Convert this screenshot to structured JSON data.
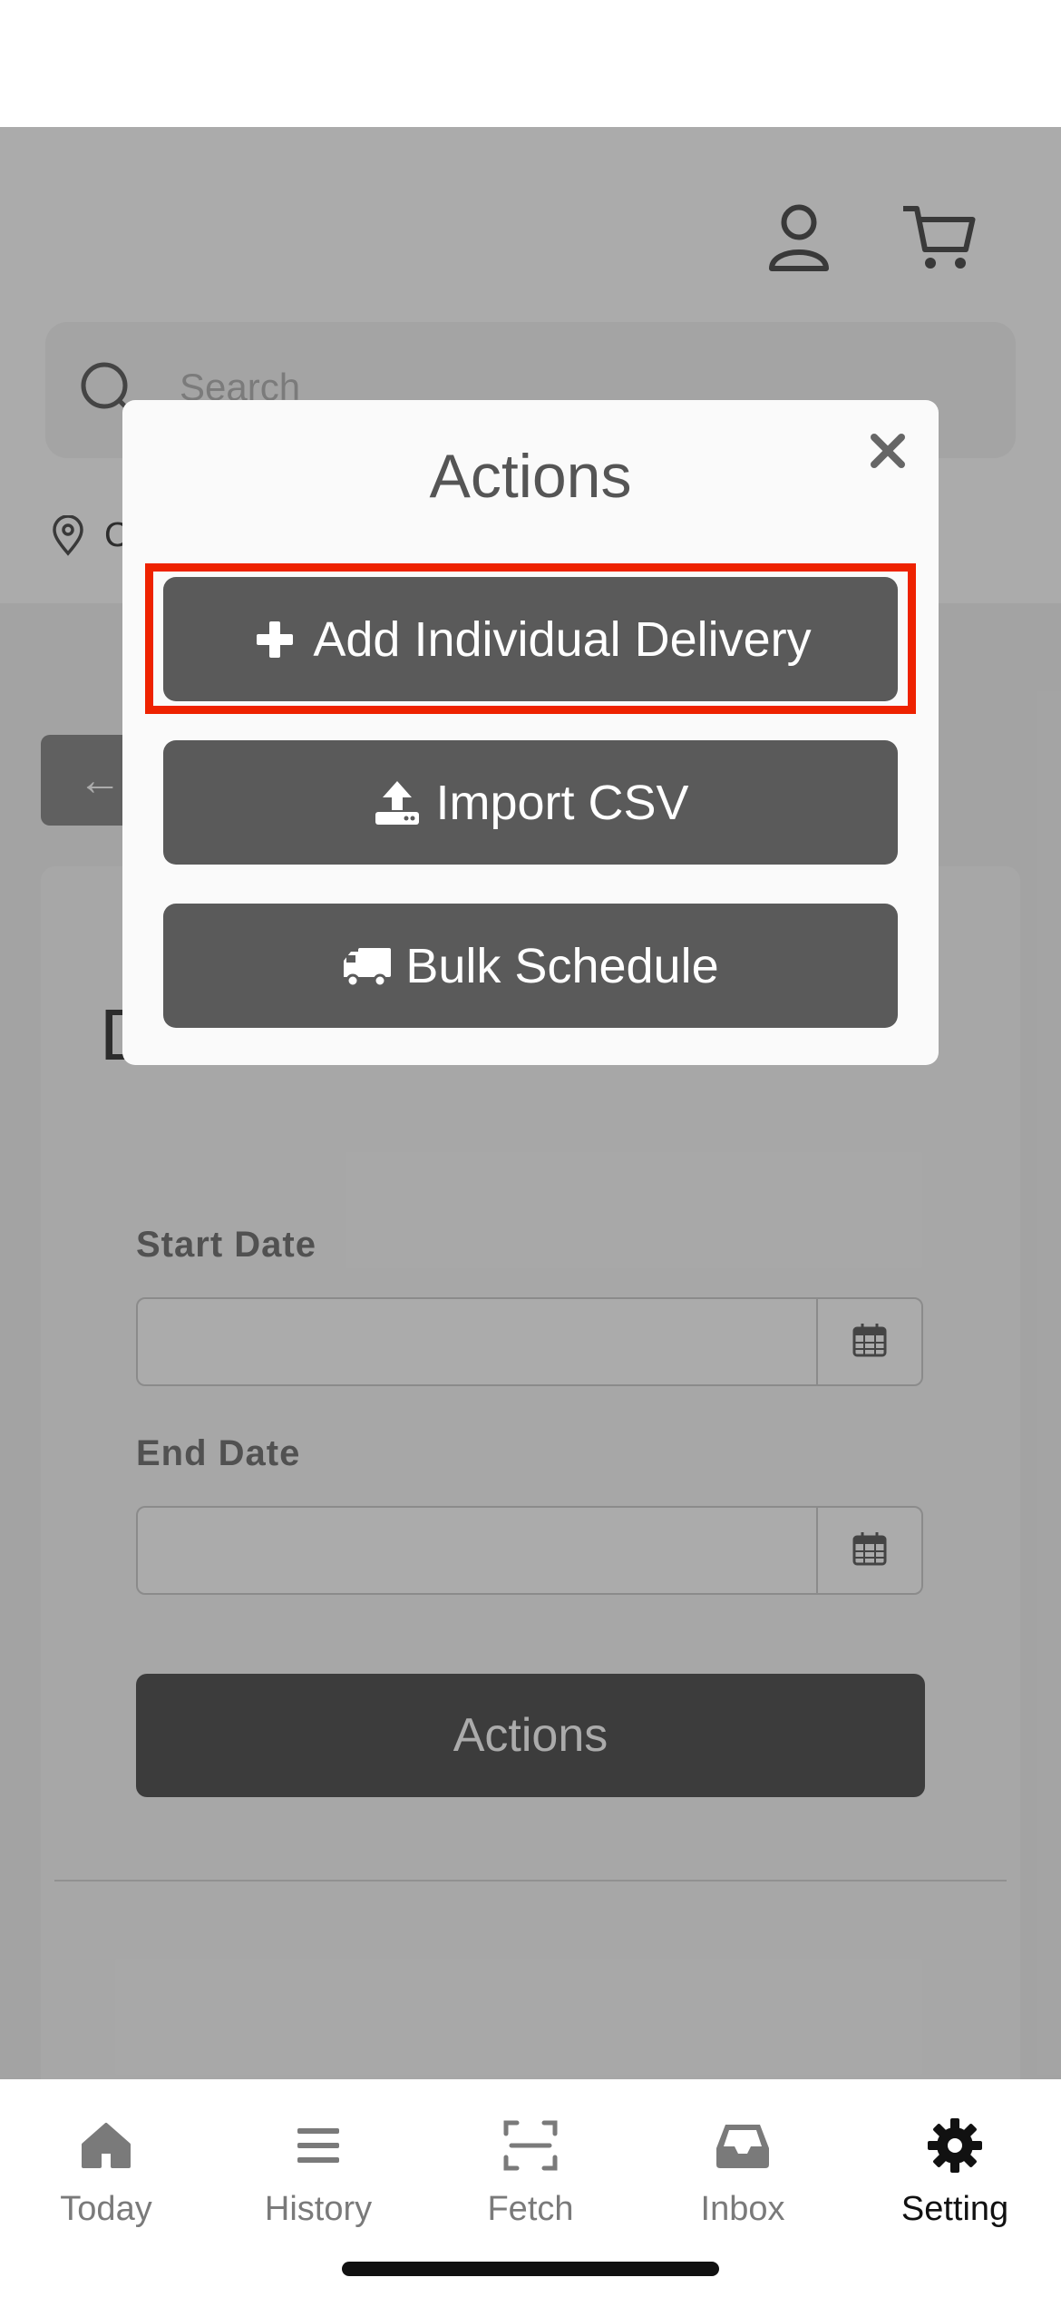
{
  "search": {
    "placeholder": "Search"
  },
  "location": {
    "text": "C"
  },
  "back_button": {
    "label": "←"
  },
  "card": {
    "heading": "D",
    "start_date_label": "Start Date",
    "end_date_label": "End Date",
    "start_date_value": "",
    "end_date_value": "",
    "actions_button": "Actions"
  },
  "modal": {
    "title": "Actions",
    "buttons": [
      {
        "label": "Add Individual Delivery",
        "icon": "plus-icon"
      },
      {
        "label": "Import CSV",
        "icon": "upload-icon"
      },
      {
        "label": "Bulk Schedule",
        "icon": "truck-icon"
      }
    ],
    "highlight_color": "#ee2200"
  },
  "bottom_nav": {
    "items": [
      {
        "label": "Today",
        "icon": "home-icon",
        "active": false
      },
      {
        "label": "History",
        "icon": "list-icon",
        "active": false
      },
      {
        "label": "Fetch",
        "icon": "scan-icon",
        "active": false
      },
      {
        "label": "Inbox",
        "icon": "inbox-icon",
        "active": false
      },
      {
        "label": "Setting",
        "icon": "gear-icon",
        "active": true
      }
    ]
  },
  "colors": {
    "button_bg": "#5a5a5a",
    "overlay": "rgba(0,0,0,0.33)",
    "nav_active": "#111111",
    "nav_inactive": "#7a7a7a"
  }
}
